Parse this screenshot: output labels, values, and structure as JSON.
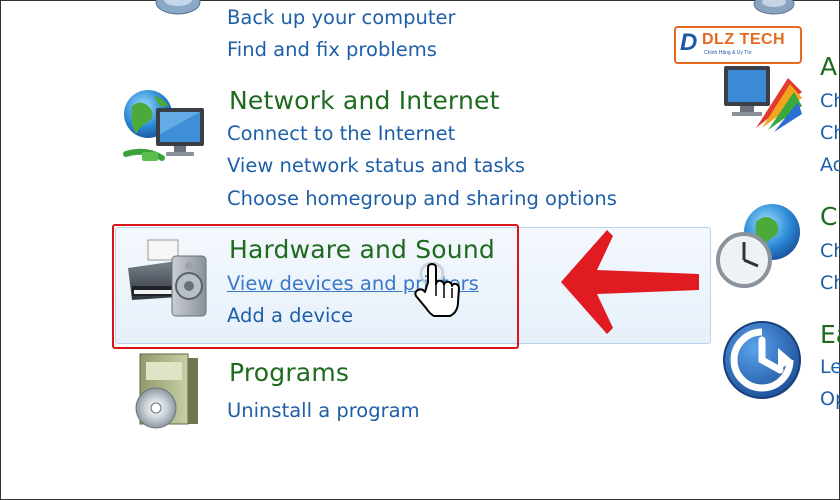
{
  "categories": {
    "system": {
      "links": [
        "Back up your computer",
        "Find and fix problems"
      ]
    },
    "network": {
      "title": "Network and Internet",
      "links": [
        "Connect to the Internet",
        "View network status and tasks",
        "Choose homegroup and sharing options"
      ]
    },
    "hardware": {
      "title": "Hardware and Sound",
      "links": [
        "View devices and printers",
        "Add a device"
      ]
    },
    "programs": {
      "title": "Programs",
      "links": [
        "Uninstall a program"
      ]
    }
  },
  "right_column": {
    "appearance": {
      "title": "A",
      "links": [
        "Ch",
        "Ch",
        "Ad"
      ]
    },
    "clock": {
      "title": "C",
      "links": [
        "Ch",
        "Ch"
      ]
    },
    "ease": {
      "title": "Ea",
      "links": [
        "Le",
        "Op"
      ]
    }
  },
  "watermark": {
    "brand": "DLZ TECH",
    "tagline": "Chính Hãng & Uy Tín"
  },
  "colors": {
    "category_title": "#1e6b1e",
    "link": "#1f5fa8",
    "highlight_border": "#d9151b",
    "arrow": "#e01b22"
  }
}
